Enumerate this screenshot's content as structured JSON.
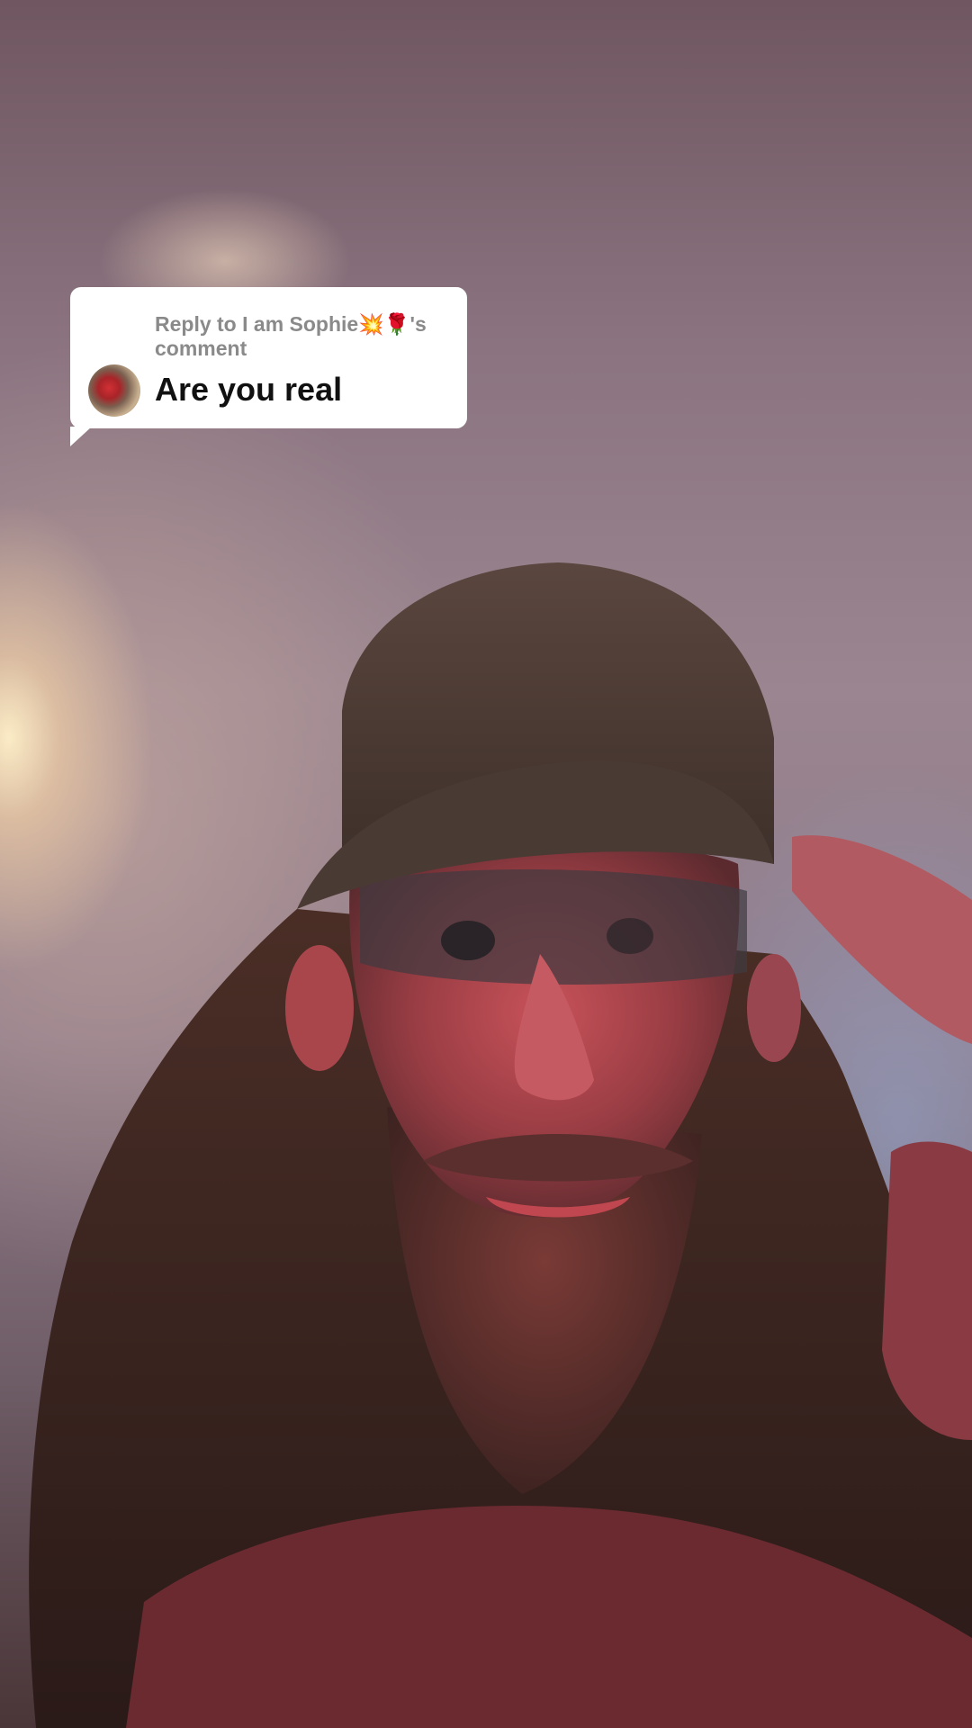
{
  "video": {
    "description_icon": "person-in-cap-video-frame"
  },
  "reply_card": {
    "prefix": "Reply to I am Sophie💥🌹's",
    "suffix": "comment",
    "comment_text": "Are you real",
    "avatar_icon": "user-avatar-icon"
  },
  "colors": {
    "bubble_bg": "#ffffff",
    "meta_text": "#8a8a8a",
    "comment_text": "#111111"
  }
}
